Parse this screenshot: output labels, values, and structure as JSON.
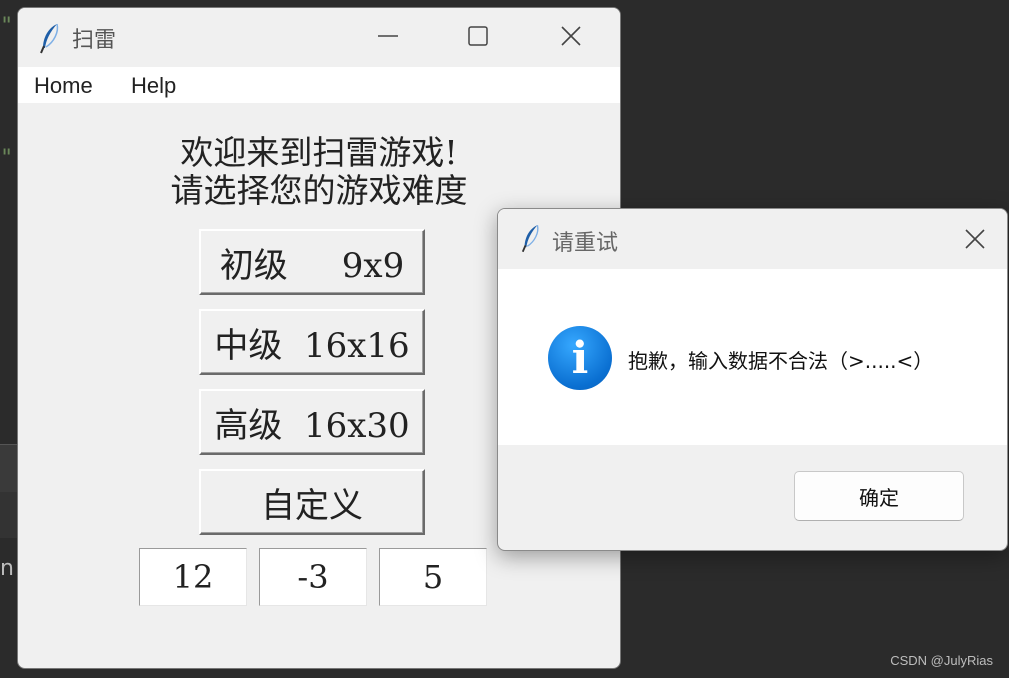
{
  "background": {
    "quote_top": "\"",
    "quote_mid": "\"",
    "fragment": "n",
    "watermark": "CSDN @JulyRias"
  },
  "main_window": {
    "title": "扫雷",
    "icon": "feather-icon",
    "menu": [
      "Home",
      "Help"
    ],
    "welcome_line1": "欢迎来到扫雷游戏!",
    "welcome_line2": "请选择您的游戏难度",
    "levels": [
      {
        "label": "初级     9x9"
      },
      {
        "label": "中级  16x16"
      },
      {
        "label": "高级  16x30"
      },
      {
        "label": "自定义"
      }
    ],
    "inputs": [
      "12",
      "-3",
      "5"
    ]
  },
  "dialog": {
    "title": "请重试",
    "icon": "info-icon",
    "info_glyph": "i",
    "message": "抱歉，输入数据不合法（>.....<）",
    "ok_label": "确定"
  },
  "colors": {
    "desktop_bg": "#2b2b2b",
    "window_bg": "#f0f0f0",
    "info_blue": "#0a6fd1"
  }
}
